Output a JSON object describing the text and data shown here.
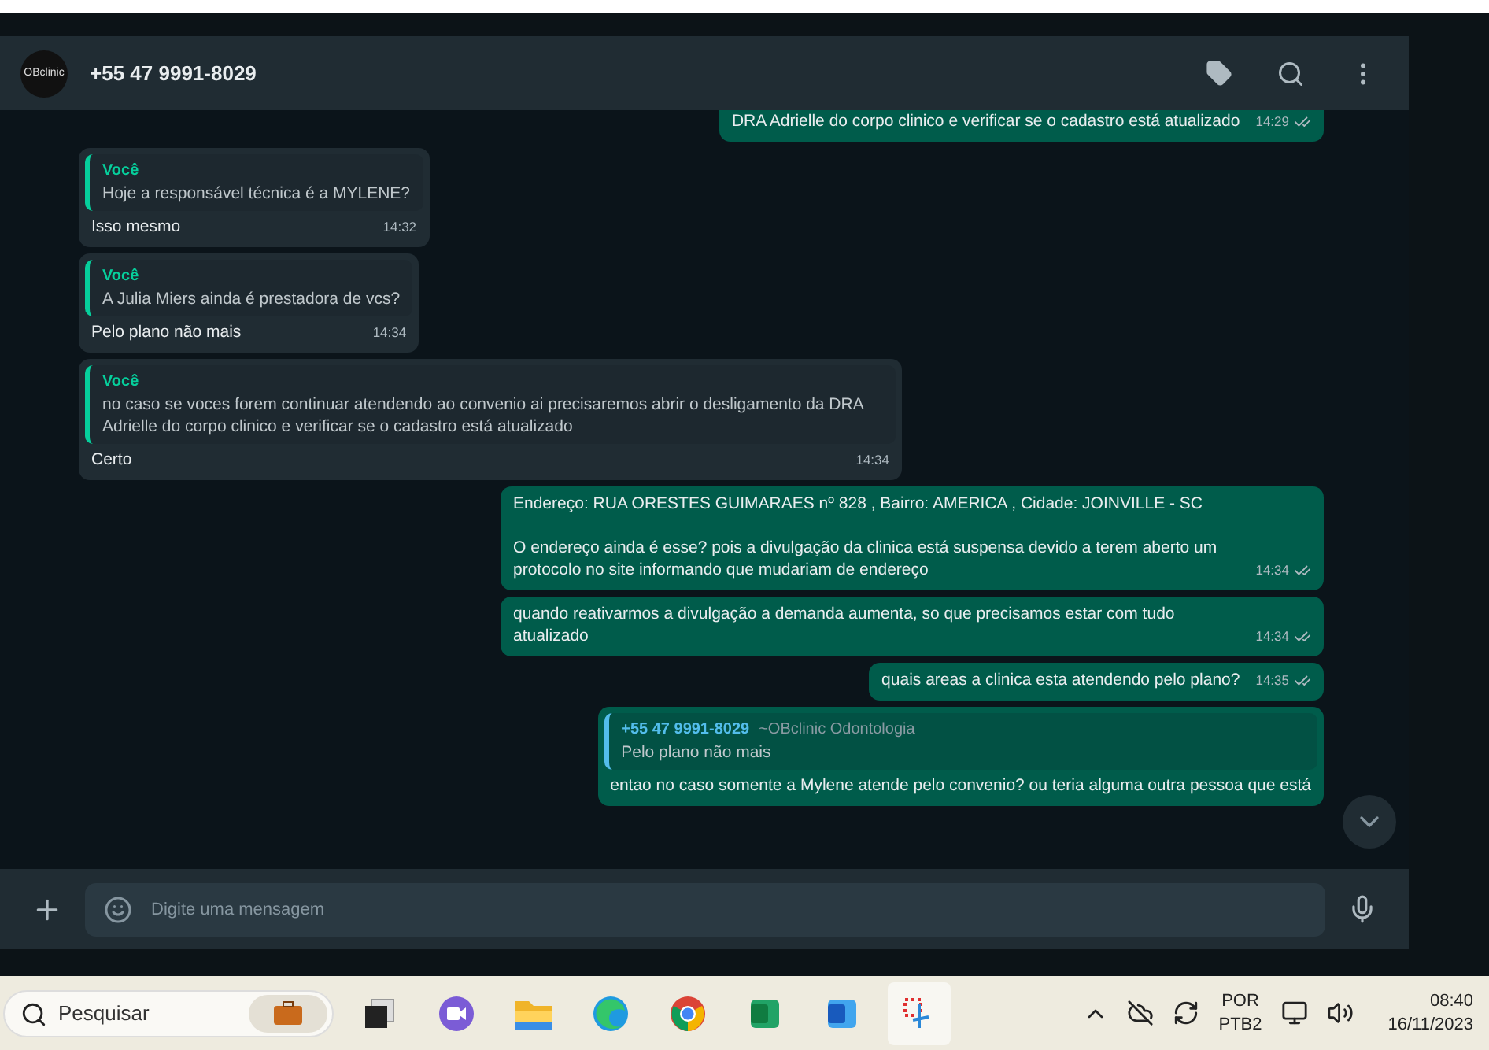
{
  "chat": {
    "contact": "+55 47 9991-8029",
    "avatar_text": "OBclinic"
  },
  "messages": [
    {
      "kind": "outgoing",
      "text": "DRA Adrielle do corpo clinico e verificar se o cadastro está atualizado",
      "time": "14:29"
    },
    {
      "kind": "incoming",
      "quote_author": "Você",
      "quote_text": "Hoje a responsável técnica é a MYLENE?",
      "text": "Isso mesmo",
      "time": "14:32"
    },
    {
      "kind": "incoming",
      "quote_author": "Você",
      "quote_text": "A Julia Miers ainda é prestadora de vcs?",
      "text": "Pelo plano não mais",
      "time": "14:34"
    },
    {
      "kind": "incoming",
      "quote_author": "Você",
      "quote_text": "no caso se voces forem continuar atendendo ao convenio ai precisaremos abrir o desligamento da DRA Adrielle do corpo clinico e verificar se o cadastro está atualizado",
      "text": "Certo",
      "time": "14:34"
    },
    {
      "kind": "outgoing",
      "text": "Endereço: RUA ORESTES GUIMARAES nº 828 , Bairro: AMERICA , Cidade: JOINVILLE - SC\n\nO endereço ainda é esse? pois a divulgação da clinica está suspensa devido a terem aberto um protocolo no site informando que mudariam de endereço",
      "time": "14:34"
    },
    {
      "kind": "outgoing",
      "text": "quando reativarmos a divulgação a demanda aumenta, so que precisamos estar com tudo atualizado",
      "time": "14:34"
    },
    {
      "kind": "outgoing",
      "text": "quais areas a clinica esta atendendo pelo plano?",
      "time": "14:35"
    },
    {
      "kind": "outgoing",
      "quote_author": "+55 47 9991-8029",
      "quote_sub": "~OBclinic Odontologia",
      "quote_text": "Pelo plano não mais",
      "text": "entao no caso somente a Mylene atende pelo convenio? ou teria alguma outra pessoa que está"
    }
  ],
  "composer": {
    "placeholder": "Digite uma mensagem"
  },
  "taskbar": {
    "search_placeholder": "Pesquisar",
    "language": "POR",
    "layout": "PTB2",
    "time": "08:40",
    "date": "16/11/2023"
  }
}
